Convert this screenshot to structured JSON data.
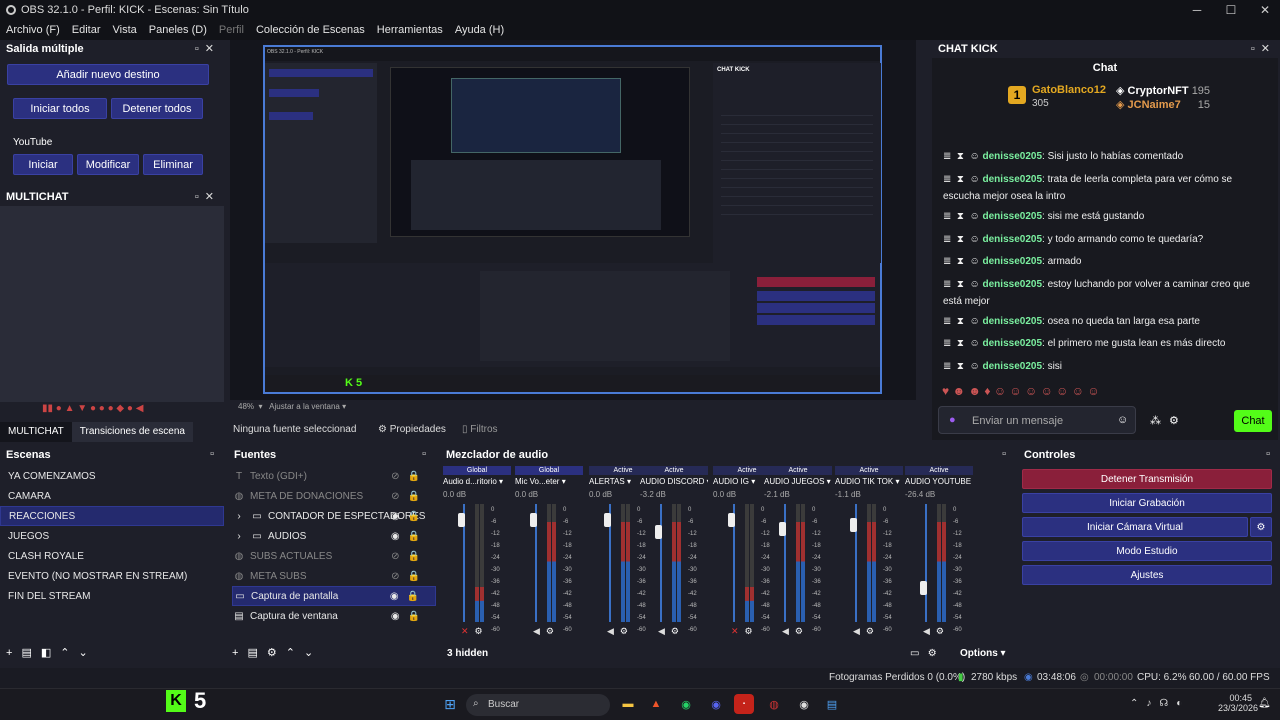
{
  "window": {
    "title": "OBS 32.1.0 - Perfil: KICK - Escenas: Sin Título",
    "min": "─",
    "max": "☐",
    "close": "✕"
  },
  "menu": [
    "Archivo (F)",
    "Editar",
    "Vista",
    "Paneles (D)",
    "Perfil",
    "Colección de Escenas",
    "Herramientas",
    "Ayuda (H)"
  ],
  "salida": {
    "title": "Salida múltiple",
    "add": "Añadir nuevo destino",
    "start_all": "Iniciar todos",
    "stop_all": "Detener todos",
    "youtube": "YouTube",
    "start": "Iniciar",
    "modify": "Modificar",
    "delete": "Eliminar"
  },
  "multichat": {
    "title": "MULTICHAT"
  },
  "tabs": {
    "multichat": "MULTICHAT",
    "transitions": "Transiciones de escena"
  },
  "preview": {
    "zoom": "48%",
    "fit": "Ajustar a la ventana"
  },
  "toolbar": {
    "no_source": "Ninguna fuente seleccionad",
    "props": "Propiedades",
    "filters": "Filtros"
  },
  "escenas": {
    "title": "Escenas",
    "items": [
      "YA COMENZAMOS",
      "CAMARA",
      "REACCIONES",
      "JUEGOS",
      "CLASH ROYALE",
      "EVENTO (NO MOSTRAR EN STREAM)",
      "FIN DEL STREAM"
    ]
  },
  "fuentes": {
    "title": "Fuentes",
    "items": [
      {
        "label": "Texto (GDI+)",
        "hidden": true,
        "icon": "text-icon"
      },
      {
        "label": "META DE DONACIONES",
        "hidden": true,
        "icon": "globe-icon"
      },
      {
        "label": "CONTADOR DE ESPECTADORES",
        "hidden": false,
        "icon": "folder-icon"
      },
      {
        "label": "AUDIOS",
        "hidden": false,
        "icon": "folder-icon"
      },
      {
        "label": "SUBS ACTUALES",
        "hidden": true,
        "icon": "globe-icon"
      },
      {
        "label": "META SUBS",
        "hidden": true,
        "icon": "globe-icon"
      },
      {
        "label": "Captura de pantalla",
        "hidden": false,
        "icon": "monitor-icon"
      },
      {
        "label": "Captura de ventana",
        "hidden": false,
        "icon": "window-icon"
      }
    ]
  },
  "mixer": {
    "title": "Mezclador de audio",
    "hidden": "3 hidden",
    "options": "Options",
    "channels": [
      {
        "hdr": "Global",
        "name": "Audio d...ritorio",
        "db": "0.0 dB",
        "level": 0.92,
        "muted": true
      },
      {
        "hdr": "Global",
        "name": "Mic Vo...eter",
        "db": "0.0 dB",
        "level": 0.92,
        "muted": false
      },
      {
        "hdr": "Active",
        "name": "ALERTAS",
        "db": "0.0 dB",
        "level": 0.92,
        "muted": false
      },
      {
        "hdr": "Active",
        "name": "AUDIO DISCORD",
        "db": "-3.2 dB",
        "level": 0.82,
        "muted": false
      },
      {
        "hdr": "Active",
        "name": "AUDIO IG",
        "db": "0.0 dB",
        "level": 0.92,
        "muted": true
      },
      {
        "hdr": "Active",
        "name": "AUDIO JUEGOS",
        "db": "-2.1 dB",
        "level": 0.85,
        "muted": false
      },
      {
        "hdr": "Active",
        "name": "AUDIO TIK TOK",
        "db": "-1.1 dB",
        "level": 0.88,
        "muted": false
      },
      {
        "hdr": "Active",
        "name": "AUDIO YOUTUBE",
        "db": "-26.4 dB",
        "level": 0.35,
        "muted": false
      }
    ],
    "ticks": [
      "0",
      "-6",
      "-12",
      "-18",
      "-24",
      "-30",
      "-36",
      "-42",
      "-48",
      "-54",
      "-60"
    ]
  },
  "controles": {
    "title": "Controles",
    "stop": "Detener Transmisión",
    "rec": "Iniciar Grabación",
    "vcam": "Iniciar Cámara Virtual",
    "studio": "Modo Estudio",
    "settings": "Ajustes"
  },
  "chat": {
    "panel": "CHAT KICK",
    "title": "Chat",
    "top1": {
      "name": "GatoBlanco12",
      "n": "305",
      "rank": "1"
    },
    "top2": {
      "name": "CryptorNFT",
      "n": "195"
    },
    "top3": {
      "name": "JCNaime7",
      "n": "15"
    },
    "messages": [
      {
        "u": "denisse0205",
        "t": "Sisi justo lo habías comentado"
      },
      {
        "u": "denisse0205",
        "t": "trata de leerla completa para ver cómo se escucha mejor osea la intro"
      },
      {
        "u": "denisse0205",
        "t": "sisi me está gustando"
      },
      {
        "u": "denisse0205",
        "t": "y todo armando como te quedaría?"
      },
      {
        "u": "denisse0205",
        "t": "armado"
      },
      {
        "u": "denisse0205",
        "t": "estoy luchando por volver a caminar creo que está mejor"
      },
      {
        "u": "denisse0205",
        "t": "osea no queda tan larga esa parte"
      },
      {
        "u": "denisse0205",
        "t": "el primero me gusta lean es más directo"
      },
      {
        "u": "denisse0205",
        "t": "sisi"
      }
    ],
    "placeholder": "Enviar un mensaje",
    "send": "Chat"
  },
  "status": {
    "dropped": "Fotogramas Perdidos 0 (0.0%)",
    "kbps": "2780 kbps",
    "live": "03:48:06",
    "rec": "00:00:00",
    "cpu": "CPU: 6.2%",
    "fps": "60.00 / 60.00 FPS"
  },
  "taskbar": {
    "search": "Buscar",
    "time": "00:45",
    "date": "23/3/2026",
    "k5": "5"
  },
  "colors": {
    "accent": "#2b3080",
    "stop": "#8a1f3a",
    "kick": "#53fc18"
  }
}
